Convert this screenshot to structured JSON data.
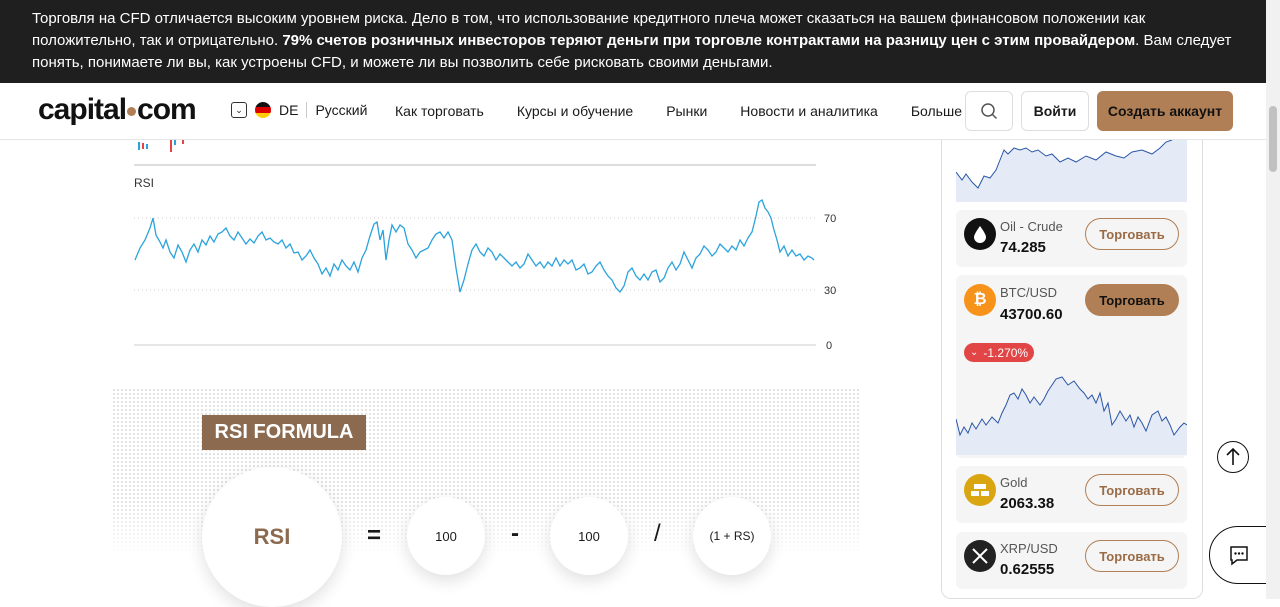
{
  "risk_warning": {
    "text_1": "Торговля на CFD отличается высоким уровнем риска. Дело в том, что использование кредитного плеча может сказаться на вашем финансовом положении как положительно, так и отрицательно. ",
    "bold": "79% счетов розничных инвесторов теряют деньги при торговле контрактами на разницу цен с этим провайдером",
    "text_2": ". Вам следует понять, понимаете ли вы, как устроены CFD, и можете ли вы позволить себе рисковать своими деньгами."
  },
  "header": {
    "logo_left": "capital",
    "logo_right": "com",
    "lang_code": "DE",
    "lang_name": "Русский",
    "nav": [
      "Как торговать",
      "Курсы и обучение",
      "Рынки",
      "Новости и аналитика",
      "Больше"
    ],
    "login": "Войти",
    "signup": "Создать аккаунт",
    "accent": "#b07f55"
  },
  "rsi_chart": {
    "label": "RSI",
    "ticks": [
      "70",
      "30",
      "0"
    ],
    "line_color": "#2aa3dc"
  },
  "formula": {
    "title": "RSI FORMULA",
    "rsi": "RSI",
    "eq": "=",
    "a": "100",
    "minus": "-",
    "b": "100",
    "div": "/",
    "c": "(1 + RS)"
  },
  "markets": [
    {
      "name": "Oil - Crude",
      "price": "74.285",
      "trade": "Торговать",
      "icon": "oil-drop-icon"
    },
    {
      "name": "BTC/USD",
      "price": "43700.60",
      "trade": "Торговать",
      "change": "-1.270%",
      "icon": "bitcoin-icon"
    },
    {
      "name": "Gold",
      "price": "2063.38",
      "trade": "Торговать",
      "icon": "gold-bars-icon"
    },
    {
      "name": "XRP/USD",
      "price": "0.62555",
      "trade": "Торговать",
      "icon": "xrp-icon"
    }
  ]
}
